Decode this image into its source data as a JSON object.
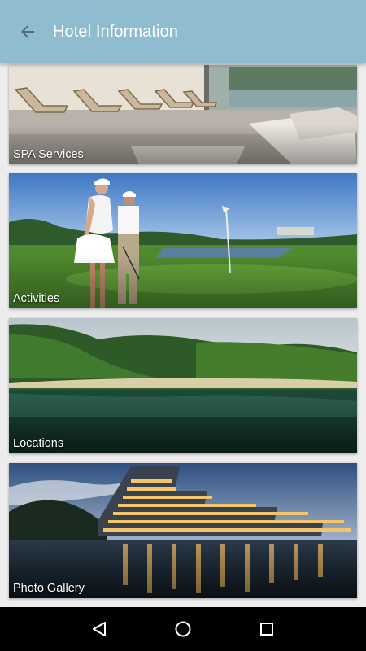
{
  "app_bar": {
    "title": "Hotel Information",
    "back_icon": "arrow-left-icon",
    "background": "#8fbccf"
  },
  "cards": [
    {
      "label": "SPA Services",
      "image": "spa-lounge-photo"
    },
    {
      "label": "Activities",
      "image": "golf-course-photo"
    },
    {
      "label": "Locations",
      "image": "bay-landscape-photo"
    },
    {
      "label": "Photo Gallery",
      "image": "hotel-night-photo"
    }
  ],
  "nav_bar": {
    "back_icon": "triangle-back-icon",
    "home_icon": "circle-home-icon",
    "recents_icon": "square-recents-icon"
  }
}
